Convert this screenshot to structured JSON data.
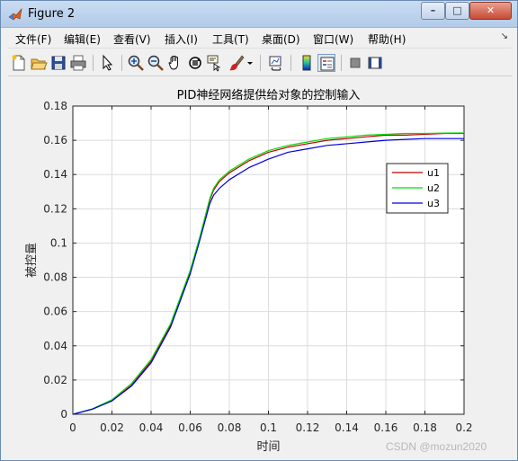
{
  "window": {
    "title": "Figure 2",
    "buttons": {
      "minimize": "–",
      "maximize": "□",
      "close": "✕"
    }
  },
  "menu": {
    "items": [
      "文件(F)",
      "编辑(E)",
      "查看(V)",
      "插入(I)",
      "工具(T)",
      "桌面(D)",
      "窗口(W)",
      "帮助(H)"
    ],
    "overflow_icon": "dock-arrow-icon"
  },
  "toolbar": {
    "icons": [
      "new-figure-icon",
      "open-file-icon",
      "save-icon",
      "print-icon",
      "select-arrow-icon",
      "zoom-in-icon",
      "zoom-out-icon",
      "pan-hand-icon",
      "rotate-3d-icon",
      "data-cursor-icon",
      "brush-icon",
      "brush-dropdown-icon",
      "link-plot-icon",
      "colorbar-icon",
      "legend-icon",
      "hide-plot-tools-icon",
      "show-plot-tools-icon"
    ]
  },
  "colors": {
    "u1": "#c00000",
    "u2": "#00dd00",
    "u3": "#0000e0"
  },
  "chart_data": {
    "type": "line",
    "title": "PID神经网络提供给对象的控制输入",
    "xlabel": "时间",
    "ylabel": "被控量",
    "xlim": [
      0,
      0.2
    ],
    "ylim": [
      0,
      0.18
    ],
    "xticks": [
      "0",
      "0.02",
      "0.04",
      "0.06",
      "0.08",
      "0.1",
      "0.12",
      "0.14",
      "0.16",
      "0.18",
      "0.2"
    ],
    "yticks": [
      "0",
      "0.02",
      "0.04",
      "0.06",
      "0.08",
      "0.1",
      "0.12",
      "0.14",
      "0.16",
      "0.18"
    ],
    "grid": true,
    "legend_position": "right",
    "x": [
      0,
      0.01,
      0.02,
      0.03,
      0.04,
      0.05,
      0.06,
      0.065,
      0.07,
      0.072,
      0.075,
      0.08,
      0.09,
      0.1,
      0.11,
      0.12,
      0.13,
      0.14,
      0.15,
      0.16,
      0.17,
      0.18,
      0.19,
      0.2
    ],
    "series": [
      {
        "name": "u1",
        "values": [
          0,
          0.003,
          0.008,
          0.017,
          0.031,
          0.052,
          0.083,
          0.103,
          0.125,
          0.131,
          0.136,
          0.141,
          0.148,
          0.153,
          0.156,
          0.158,
          0.16,
          0.161,
          0.162,
          0.163,
          0.163,
          0.1635,
          0.164,
          0.164
        ]
      },
      {
        "name": "u2",
        "values": [
          0,
          0.0032,
          0.0085,
          0.018,
          0.032,
          0.053,
          0.084,
          0.104,
          0.126,
          0.132,
          0.137,
          0.142,
          0.149,
          0.154,
          0.157,
          0.159,
          0.161,
          0.162,
          0.163,
          0.1635,
          0.164,
          0.164,
          0.1642,
          0.1643
        ]
      },
      {
        "name": "u3",
        "values": [
          0,
          0.003,
          0.0078,
          0.0165,
          0.03,
          0.051,
          0.082,
          0.102,
          0.123,
          0.128,
          0.132,
          0.137,
          0.144,
          0.149,
          0.153,
          0.155,
          0.157,
          0.158,
          0.159,
          0.16,
          0.1605,
          0.161,
          0.161,
          0.161
        ]
      }
    ]
  },
  "watermark": "CSDN @mozun2020"
}
